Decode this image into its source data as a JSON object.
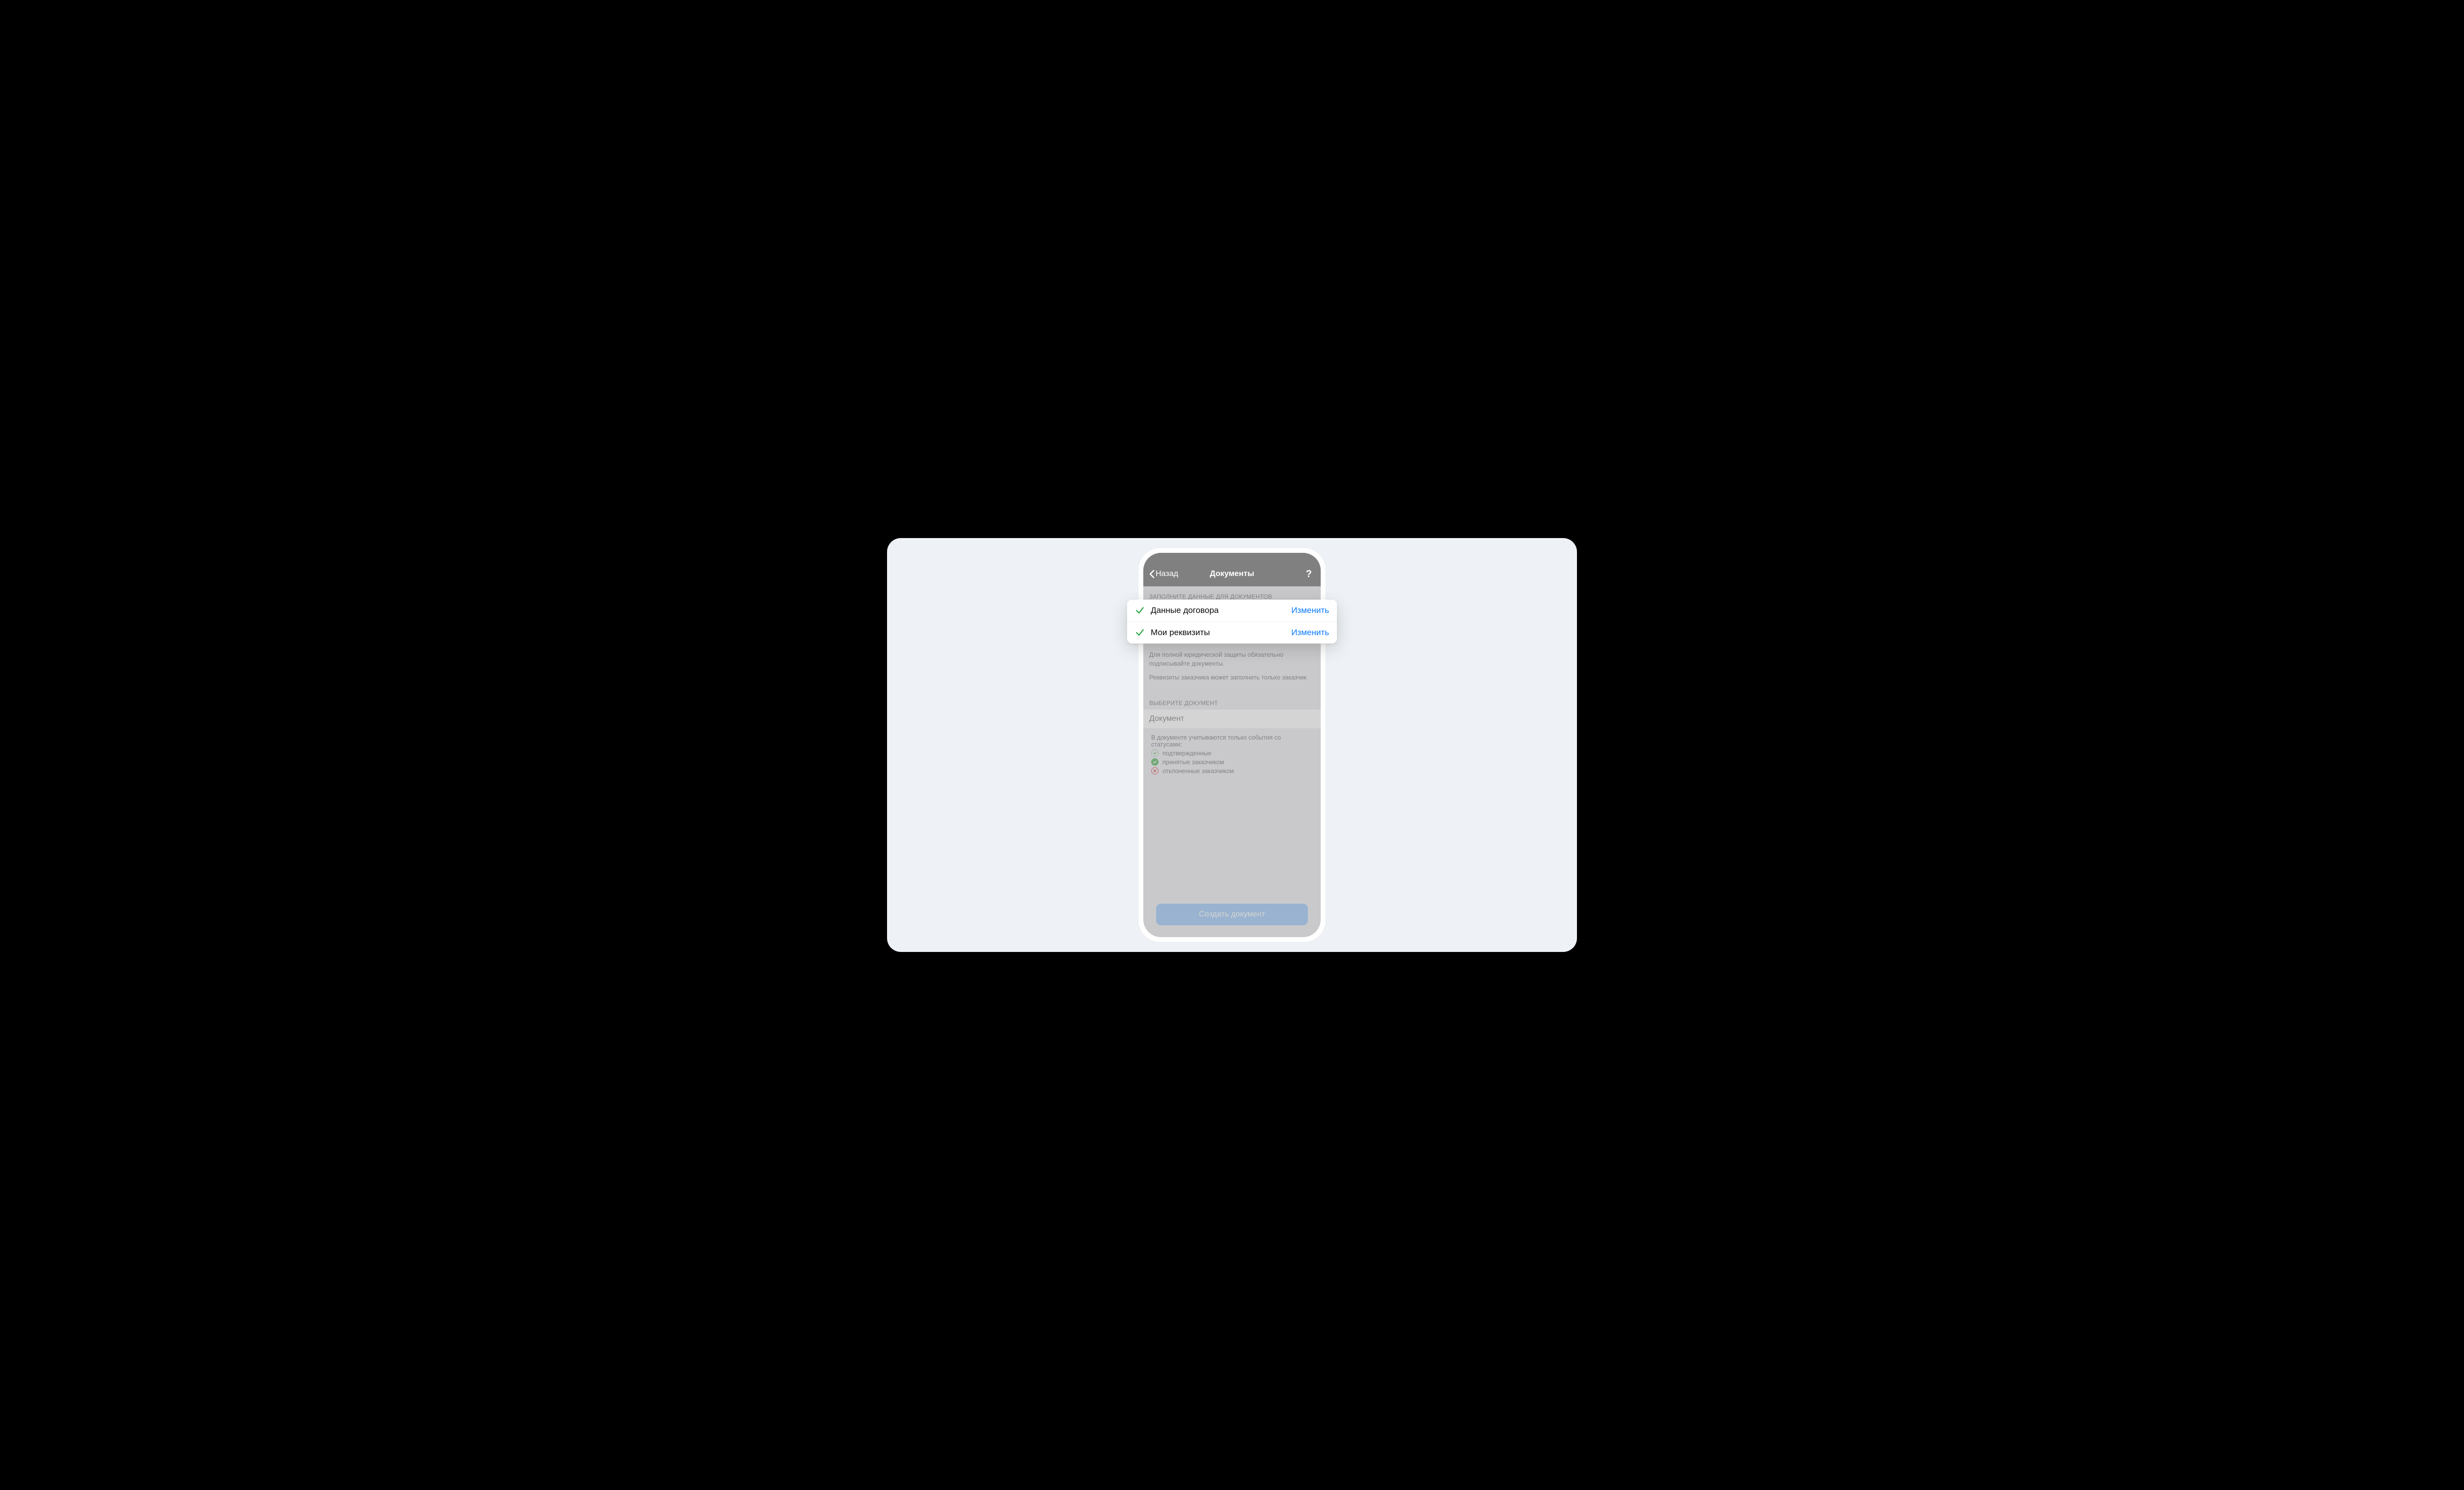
{
  "nav": {
    "back_label": "Назад",
    "title": "Документы",
    "help": "?"
  },
  "sections": {
    "fill_header": "ЗАПОЛНИТЕ ДАННЫЕ ДЛЯ ДОКУМЕНТОВ",
    "choose_header": "ВЫБЕРИТЕ ДОКУМЕНТ"
  },
  "items": {
    "contract_data": {
      "label": "Данные договора",
      "action": "Изменить"
    },
    "my_req": {
      "label": "Мои реквизиты",
      "action": "Изменить"
    }
  },
  "notes": {
    "protection": "Для полной юридической защиты обязательно подписывайте документы.",
    "client_req": "Реквизиты заказчика может заполнить только заказчик"
  },
  "doc_select": {
    "placeholder": "Документ"
  },
  "statuses": {
    "intro": "В документе учитываются только события со статусами:",
    "confirmed": "подтвержденные",
    "accepted": "принятые заказчиком",
    "rejected": "отклоненные заказчиком"
  },
  "footer": {
    "create_label": "Создать документ"
  }
}
